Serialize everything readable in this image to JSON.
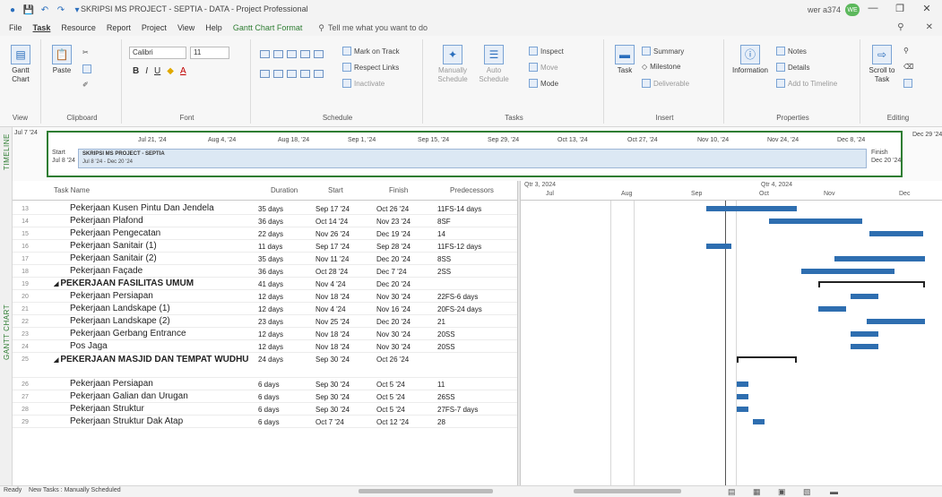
{
  "window": {
    "title": "SKRIPSI MS PROJECT - SEPTIA - DATA - Project Professional",
    "user": "wer a374",
    "avatar_initials": "WE"
  },
  "menu": {
    "tabs": [
      "File",
      "Task",
      "Resource",
      "Report",
      "Project",
      "View",
      "Help",
      "Gantt Chart Format"
    ],
    "tell_me": "Tell me what you want to do"
  },
  "ribbon": {
    "view": {
      "button": "Gantt Chart",
      "label": "View"
    },
    "clipboard": {
      "paste": "Paste",
      "label": "Clipboard"
    },
    "font": {
      "font_name": "Calibri",
      "font_size": "11",
      "label": "Font"
    },
    "schedule": {
      "mark_on_track": "Mark on Track",
      "respect_links": "Respect Links",
      "inactivate": "Inactivate",
      "label": "Schedule"
    },
    "tasks": {
      "manually": "Manually Schedule",
      "auto": "Auto Schedule",
      "inspect": "Inspect",
      "move": "Move",
      "mode": "Mode",
      "label": "Tasks"
    },
    "insert": {
      "task": "Task",
      "summary": "Summary",
      "milestone": "Milestone",
      "deliverable": "Deliverable",
      "label": "Insert"
    },
    "properties": {
      "information": "Information",
      "notes": "Notes",
      "details": "Details",
      "add_timeline": "Add to Timeline",
      "label": "Properties"
    },
    "editing": {
      "scroll": "Scroll to Task",
      "label": "Editing"
    }
  },
  "timeline": {
    "side_label": "TIMELINE",
    "ticks": [
      "Jul 21, '24",
      "Aug 4, '24",
      "Aug 18, '24",
      "Sep 1, '24",
      "Sep 15, '24",
      "Sep 29, '24",
      "Oct 13, '24",
      "Oct 27, '24",
      "Nov 10, '24",
      "Nov 24, '24",
      "Dec 8, '24"
    ],
    "start_label": "Start",
    "start_date": "Jul 8 '24",
    "finish_label": "Finish",
    "finish_date": "Dec 20 '24",
    "project_name": "SKRIPSI MS PROJECT - SEPTIA",
    "project_dates": "Jul 8 '24 - Dec 20 '24",
    "left_date": "Jul 7 '24",
    "right_date": "Dec 29 '24"
  },
  "gantt": {
    "side_label": "GANTT CHART",
    "columns": [
      "Task Name",
      "Duration",
      "Start",
      "Finish",
      "Predecessors"
    ],
    "quarters": [
      "Qtr 3, 2024",
      "Qtr 4, 2024"
    ],
    "months": [
      "Jul",
      "Aug",
      "Sep",
      "Oct",
      "Nov",
      "Dec"
    ],
    "rows": [
      {
        "id": "13",
        "name": "Pekerjaan Kusen Pintu Dan Jendela",
        "duration": "35 days",
        "start": "Sep 17 '24",
        "finish": "Oct 26 '24",
        "pred": "11FS-14 days",
        "summary": false
      },
      {
        "id": "14",
        "name": "Pekerjaan Plafond",
        "duration": "36 days",
        "start": "Oct 14 '24",
        "finish": "Nov 23 '24",
        "pred": "8SF",
        "summary": false
      },
      {
        "id": "15",
        "name": "Pekerjaan Pengecatan",
        "duration": "22 days",
        "start": "Nov 26 '24",
        "finish": "Dec 19 '24",
        "pred": "14",
        "summary": false
      },
      {
        "id": "16",
        "name": "Pekerjaan Sanitair (1)",
        "duration": "11 days",
        "start": "Sep 17 '24",
        "finish": "Sep 28 '24",
        "pred": "11FS-12 days",
        "summary": false
      },
      {
        "id": "17",
        "name": "Pekerjaan Sanitair (2)",
        "duration": "35 days",
        "start": "Nov 11 '24",
        "finish": "Dec 20 '24",
        "pred": "8SS",
        "summary": false
      },
      {
        "id": "18",
        "name": "Pekerjaan Façade",
        "duration": "36 days",
        "start": "Oct 28 '24",
        "finish": "Dec 7 '24",
        "pred": "2SS",
        "summary": false
      },
      {
        "id": "19",
        "name": "PEKERJAAN FASILITAS UMUM",
        "duration": "41 days",
        "start": "Nov 4 '24",
        "finish": "Dec 20 '24",
        "pred": "",
        "summary": true
      },
      {
        "id": "20",
        "name": "Pekerjaan Persiapan",
        "duration": "12 days",
        "start": "Nov 18 '24",
        "finish": "Nov 30 '24",
        "pred": "22FS-6 days",
        "summary": false
      },
      {
        "id": "21",
        "name": "Pekerjaan Landskape (1)",
        "duration": "12 days",
        "start": "Nov 4 '24",
        "finish": "Nov 16 '24",
        "pred": "20FS-24 days",
        "summary": false
      },
      {
        "id": "22",
        "name": "Pekerjaan Landskape (2)",
        "duration": "23 days",
        "start": "Nov 25 '24",
        "finish": "Dec 20 '24",
        "pred": "21",
        "summary": false
      },
      {
        "id": "23",
        "name": "Pekerjaan Gerbang Entrance",
        "duration": "12 days",
        "start": "Nov 18 '24",
        "finish": "Nov 30 '24",
        "pred": "20SS",
        "summary": false
      },
      {
        "id": "24",
        "name": "Pos Jaga",
        "duration": "12 days",
        "start": "Nov 18 '24",
        "finish": "Nov 30 '24",
        "pred": "20SS",
        "summary": false
      },
      {
        "id": "25",
        "name": "PEKERJAAN MASJID DAN TEMPAT WUDHU",
        "duration": "24 days",
        "start": "Sep 30 '24",
        "finish": "Oct 26 '24",
        "pred": "",
        "summary": true
      },
      {
        "id": "26",
        "name": "Pekerjaan Persiapan",
        "duration": "6 days",
        "start": "Sep 30 '24",
        "finish": "Oct 5 '24",
        "pred": "11",
        "summary": false
      },
      {
        "id": "27",
        "name": "Pekerjaan Galian dan Urugan",
        "duration": "6 days",
        "start": "Sep 30 '24",
        "finish": "Oct 5 '24",
        "pred": "26SS",
        "summary": false
      },
      {
        "id": "28",
        "name": "Pekerjaan Struktur",
        "duration": "6 days",
        "start": "Sep 30 '24",
        "finish": "Oct 5 '24",
        "pred": "27FS-7 days",
        "summary": false
      },
      {
        "id": "29",
        "name": "Pekerjaan Struktur Dak Atap",
        "duration": "6 days",
        "start": "Oct 7 '24",
        "finish": "Oct 12 '24",
        "pred": "28",
        "summary": false
      }
    ]
  },
  "status_bar": {
    "ready": "Ready",
    "new_tasks": "New Tasks : Manually Scheduled"
  }
}
